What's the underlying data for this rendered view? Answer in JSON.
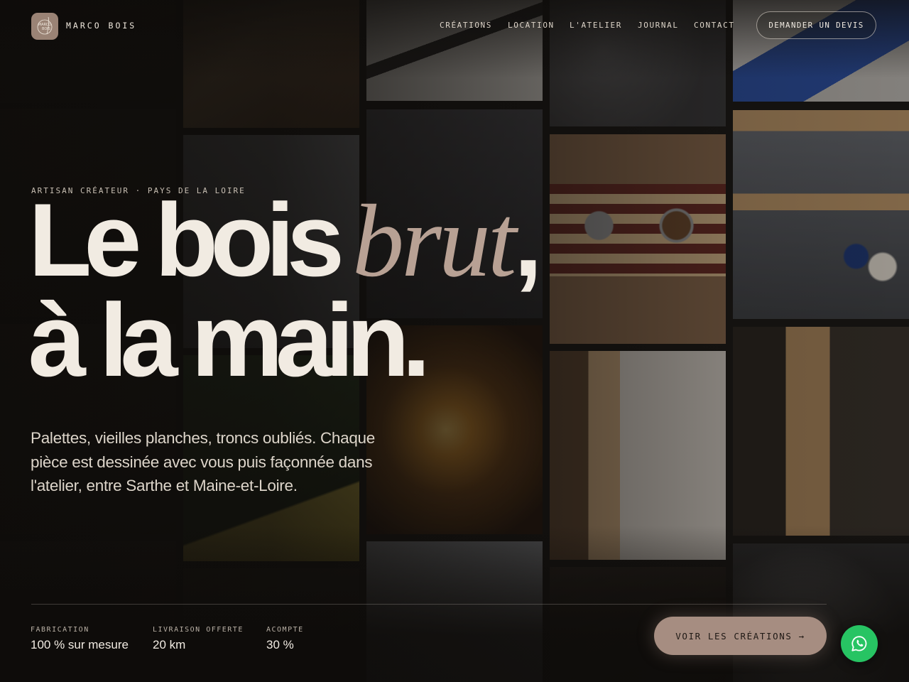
{
  "header": {
    "brand": "MARCO BOIS",
    "logo_text_top": "MARCO",
    "logo_text_bottom": "BOIS",
    "nav": [
      {
        "label": "CRÉATIONS"
      },
      {
        "label": "LOCATION"
      },
      {
        "label": "L'ATELIER"
      },
      {
        "label": "JOURNAL"
      },
      {
        "label": "CONTACT"
      }
    ],
    "cta_label": "DEMANDER UN DEVIS"
  },
  "hero": {
    "eyebrow": "ARTISAN CRÉATEUR · PAYS DE LA LOIRE",
    "title_part1": "Le bois",
    "title_accent": "brut",
    "title_comma": ",",
    "title_line2": "à la main.",
    "lead": "Palettes, vieilles planches, troncs oubliés. Chaque pièce est dessinée avec vous puis façonnée dans l'atelier, entre Sarthe et Maine-et-Loire."
  },
  "stats": [
    {
      "label": "FABRICATION",
      "value": "100 % sur mesure"
    },
    {
      "label": "LIVRAISON OFFERTE",
      "value": "20 km"
    },
    {
      "label": "ACOMPTE",
      "value": "30 %"
    }
  ],
  "cta": {
    "label": "VOIR LES CRÉATIONS →"
  },
  "whatsapp": {
    "icon": "whatsapp-icon",
    "color": "#27c463"
  },
  "colors": {
    "background": "#141210",
    "text": "#f1ebe2",
    "accent": "#b8a194",
    "cta_bg": "#a68d81"
  }
}
